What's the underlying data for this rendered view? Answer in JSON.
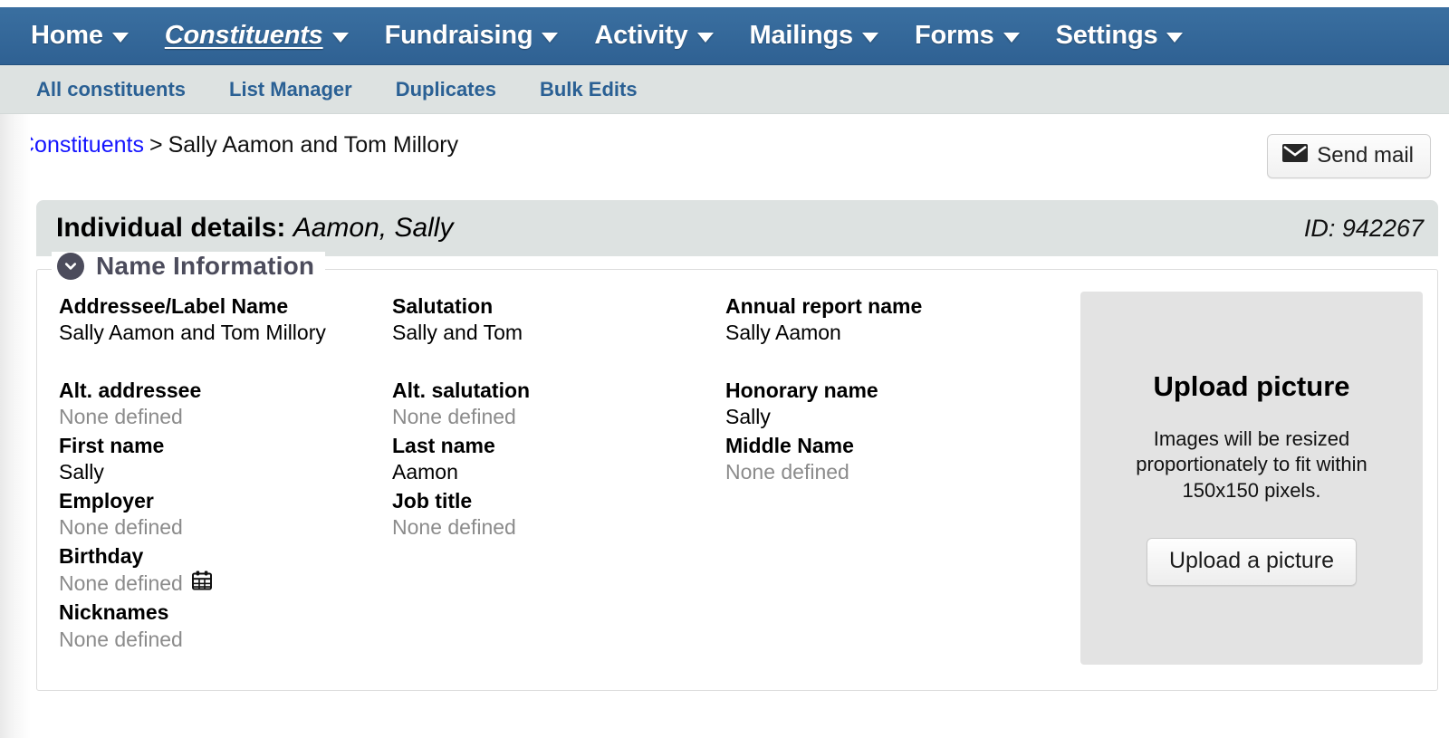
{
  "topnav": {
    "items": [
      {
        "label": "Home",
        "icon": "chevron-down-icon",
        "active": false
      },
      {
        "label": "Constituents",
        "icon": "chevron-down-icon",
        "active": true
      },
      {
        "label": "Fundraising",
        "icon": "chevron-down-icon",
        "active": false
      },
      {
        "label": "Activity",
        "icon": "chevron-down-icon",
        "active": false
      },
      {
        "label": "Mailings",
        "icon": "chevron-down-icon",
        "active": false
      },
      {
        "label": "Forms",
        "icon": "chevron-down-icon",
        "active": false
      },
      {
        "label": "Settings",
        "icon": "chevron-down-icon",
        "active": false
      }
    ],
    "background_color": "#336699",
    "text_color": "#ffffff"
  },
  "subnav": {
    "background_color": "#dde2e1",
    "link_color": "#2a6094",
    "items": [
      {
        "label": "All constituents"
      },
      {
        "label": "List Manager"
      },
      {
        "label": "Duplicates"
      },
      {
        "label": "Bulk Edits"
      }
    ]
  },
  "breadcrumb": {
    "root_label": "Constituents",
    "separator": ">",
    "current_label": "Sally Aamon and Tom Millory",
    "link_color": "#1414ff"
  },
  "actions": {
    "send_mail_label": "Send mail",
    "send_mail_icon": "envelope-icon"
  },
  "details_header": {
    "prefix": "Individual details:",
    "name": "Aamon, Sally",
    "id_label": "ID: 942267",
    "background_color": "#dde2e1"
  },
  "section": {
    "legend": "Name Information",
    "legend_icon": "chevron-down-circle-icon",
    "legend_color": "#4c4c5c",
    "columns": [
      {
        "fields": [
          {
            "label": "Addressee/Label Name",
            "value": "Sally Aamon and Tom Millory",
            "empty": false,
            "gap": true
          },
          {
            "label": "Alt. addressee",
            "value": "None defined",
            "empty": true,
            "gap": false
          },
          {
            "label": "First name",
            "value": "Sally",
            "empty": false,
            "gap": false
          },
          {
            "label": "Employer",
            "value": "None defined",
            "empty": true,
            "gap": false
          },
          {
            "label": "Birthday",
            "value": "None defined",
            "empty": true,
            "gap": false,
            "icon": "calendar-icon"
          },
          {
            "label": "Nicknames",
            "value": "None defined",
            "empty": true,
            "gap": false
          }
        ]
      },
      {
        "fields": [
          {
            "label": "Salutation",
            "value": "Sally and Tom",
            "empty": false,
            "gap": true
          },
          {
            "label": "Alt. salutation",
            "value": "None defined",
            "empty": true,
            "gap": false
          },
          {
            "label": "Last name",
            "value": "Aamon",
            "empty": false,
            "gap": false
          },
          {
            "label": "Job title",
            "value": "None defined",
            "empty": true,
            "gap": false
          }
        ]
      },
      {
        "fields": [
          {
            "label": "Annual report name",
            "value": "Sally Aamon",
            "empty": false,
            "gap": true
          },
          {
            "label": "Honorary name",
            "value": "Sally",
            "empty": false,
            "gap": false
          },
          {
            "label": "Middle Name",
            "value": "None defined",
            "empty": true,
            "gap": false
          }
        ]
      }
    ],
    "upload_panel": {
      "title": "Upload picture",
      "description": "Images will be resized proportionately to fit within 150x150 pixels.",
      "button_label": "Upload a picture",
      "background_color": "#e3e3e3"
    }
  }
}
